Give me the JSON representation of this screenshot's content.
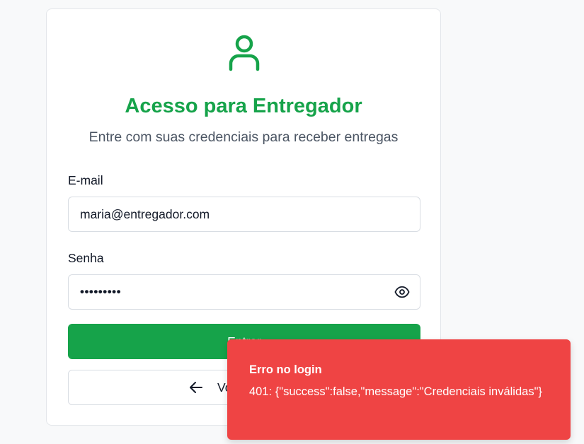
{
  "login": {
    "title": "Acesso para Entregador",
    "subtitle": "Entre com suas credenciais para receber entregas",
    "email_label": "E-mail",
    "email_value": "maria@entregador.com",
    "password_label": "Senha",
    "password_value": "•••••••••",
    "submit_label": "Entrar",
    "back_label": "Voltar"
  },
  "toast": {
    "title": "Erro no login",
    "message": "401: {\"success\":false,\"message\":\"Credenciais inválidas\"}"
  },
  "icons": {
    "header": "user-icon",
    "password_toggle": "eye-icon",
    "back": "arrow-left-icon"
  },
  "colors": {
    "accent": "#16a34a",
    "error": "#ef4444"
  }
}
